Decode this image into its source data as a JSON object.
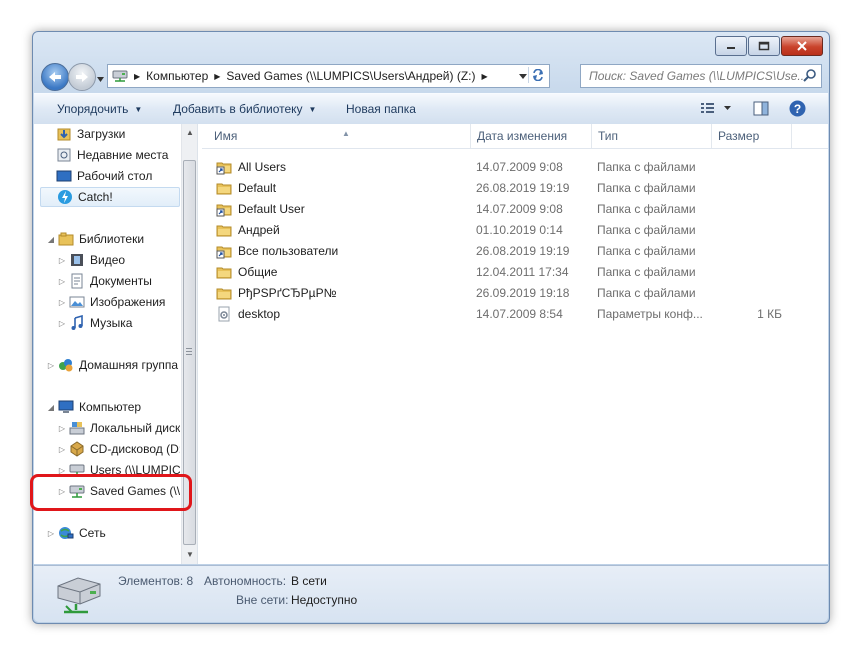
{
  "window": {
    "controls": {
      "minimize_icon": "minimize-icon",
      "maximize_icon": "maximize-icon",
      "close_icon": "close-icon"
    }
  },
  "address_bar": {
    "crumbs": [
      "Компьютер",
      "Saved Games (\\\\LUMPICS\\Users\\Андрей) (Z:)"
    ],
    "search_placeholder": "Поиск: Saved Games (\\\\LUMPICS\\Use..."
  },
  "toolbar": {
    "organize": "Упорядочить",
    "add_to_library": "Добавить в библиотеку",
    "new_folder": "Новая папка"
  },
  "nav": {
    "favorites": [
      "Загрузки",
      "Недавние места",
      "Рабочий стол",
      "Catch!"
    ],
    "libraries": {
      "label": "Библиотеки",
      "children": [
        "Видео",
        "Документы",
        "Изображения",
        "Музыка"
      ]
    },
    "homegroup": "Домашняя группа",
    "computer": {
      "label": "Компьютер",
      "children": [
        "Локальный диск (C:)",
        "CD-дисковод (D:)",
        "Users (\\\\LUMPICS) (Y:)",
        "Saved Games (\\\\LUMPICS) (Z:)"
      ]
    },
    "network": "Сеть"
  },
  "columns": {
    "name": "Имя",
    "date": "Дата изменения",
    "type": "Тип",
    "size": "Размер"
  },
  "files": [
    {
      "name": "All Users",
      "date": "14.07.2009 9:08",
      "type": "Папка с файлами",
      "size": "",
      "icon": "folder-shortcut-icon"
    },
    {
      "name": "Default",
      "date": "26.08.2019 19:19",
      "type": "Папка с файлами",
      "size": "",
      "icon": "folder-icon"
    },
    {
      "name": "Default User",
      "date": "14.07.2009 9:08",
      "type": "Папка с файлами",
      "size": "",
      "icon": "folder-shortcut-icon"
    },
    {
      "name": "Андрей",
      "date": "01.10.2019 0:14",
      "type": "Папка с файлами",
      "size": "",
      "icon": "folder-icon"
    },
    {
      "name": "Все пользователи",
      "date": "26.08.2019 19:19",
      "type": "Папка с файлами",
      "size": "",
      "icon": "folder-shortcut-icon"
    },
    {
      "name": "Общие",
      "date": "12.04.2011 17:34",
      "type": "Папка с файлами",
      "size": "",
      "icon": "folder-icon"
    },
    {
      "name": "РђРЅРґСЂРµР№",
      "date": "26.09.2019 19:18",
      "type": "Папка с файлами",
      "size": "",
      "icon": "folder-icon"
    },
    {
      "name": "desktop",
      "date": "14.07.2009 8:54",
      "type": "Параметры конф...",
      "size": "1 КБ",
      "icon": "settings-file-icon"
    }
  ],
  "status": {
    "items_label": "Элементов: 8",
    "offline_label": "Автономность:",
    "offline_value": "В сети",
    "unavailable_label": "Вне сети:",
    "unavailable_value": "Недоступно"
  },
  "colors": {
    "highlight": "#e0161a",
    "folder": "#e8c25a",
    "accent": "#3b78c4"
  }
}
